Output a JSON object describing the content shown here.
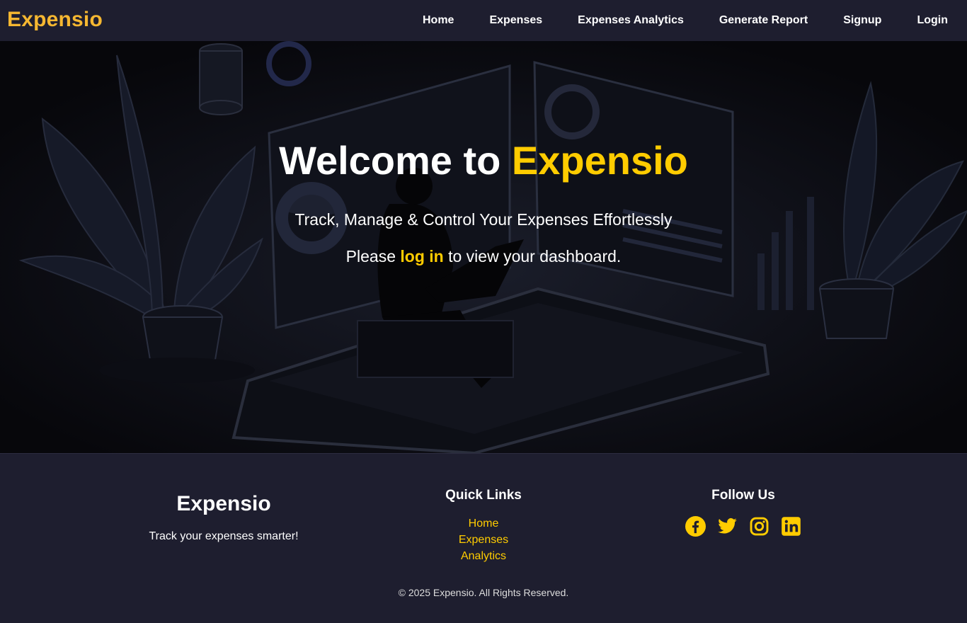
{
  "navbar": {
    "brand": "Expensio",
    "links": [
      "Home",
      "Expenses",
      "Expenses Analytics",
      "Generate Report",
      "Signup",
      "Login"
    ]
  },
  "hero": {
    "title_prefix": "Welcome to ",
    "title_accent": "Expensio",
    "subtitle": "Track, Manage & Control Your Expenses Effortlessly",
    "login_prefix": "Please ",
    "login_link": "log in",
    "login_suffix": " to view your dashboard."
  },
  "footer": {
    "brand": "Expensio",
    "tagline": "Track your expenses smarter!",
    "quick_links_title": "Quick Links",
    "quick_links": [
      "Home",
      "Expenses",
      "Analytics"
    ],
    "follow_title": "Follow Us",
    "social_icons": [
      "facebook-icon",
      "twitter-icon",
      "instagram-icon",
      "linkedin-icon"
    ],
    "copyright": "© 2025 Expensio. All Rights Reserved."
  },
  "colors": {
    "brand_orange": "#f5b731",
    "accent_yellow": "#ffcc00",
    "nav_bg": "#1e1e2f",
    "hero_bg": "#0b0b10"
  }
}
